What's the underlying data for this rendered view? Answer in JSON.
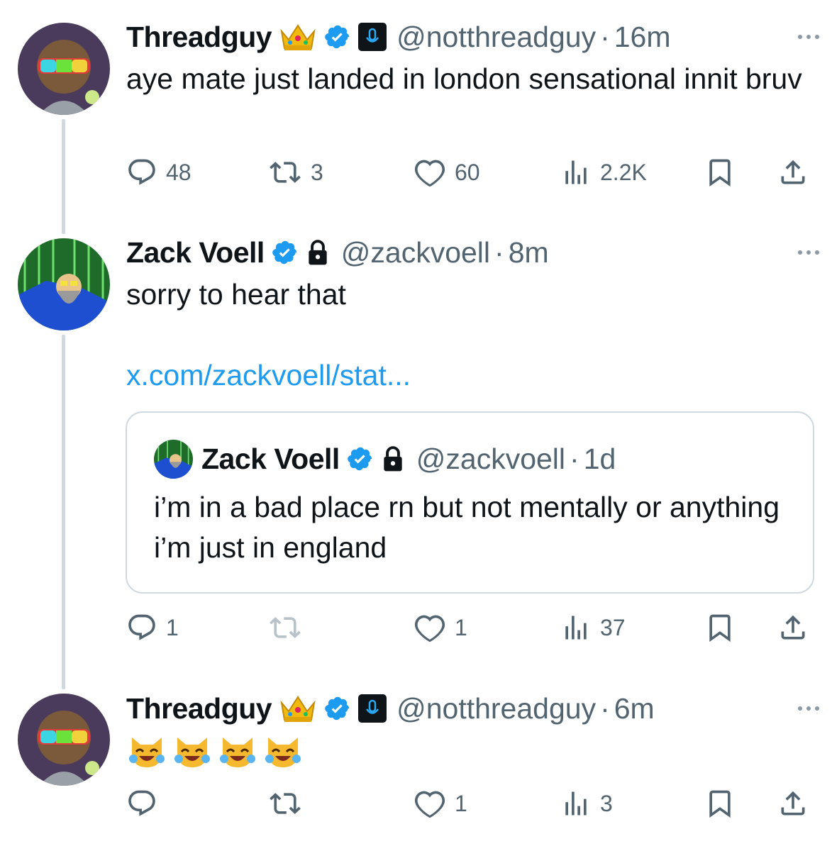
{
  "tweets": [
    {
      "display_name": "Threadguy",
      "handle": "@notthreadguy",
      "separator": "·",
      "time": "16m",
      "text": "aye mate just landed in london sensational innit bruv",
      "stats": {
        "replies": "48",
        "reposts": "3",
        "likes": "60",
        "views": "2.2K"
      }
    },
    {
      "display_name": "Zack Voell",
      "handle": "@zackvoell",
      "separator": "·",
      "time": "8m",
      "text": "sorry to hear that",
      "link": "x.com/zackvoell/stat...",
      "quote": {
        "display_name": "Zack Voell",
        "handle": "@zackvoell",
        "separator": "·",
        "time": "1d",
        "text": "i’m in a bad place rn but not mentally or anything i’m just in england"
      },
      "stats": {
        "replies": "1",
        "reposts": "",
        "likes": "1",
        "views": "37"
      }
    },
    {
      "display_name": "Threadguy",
      "handle": "@notthreadguy",
      "separator": "·",
      "time": "6m",
      "emojis": [
        "crying-laughing-cat",
        "crying-laughing-cat",
        "crying-laughing-cat",
        "crying-laughing-cat"
      ],
      "stats": {
        "replies": "",
        "reposts": "",
        "likes": "1",
        "views": "3"
      }
    }
  ],
  "icons": {
    "reply": "reply-icon",
    "repost": "repost-icon",
    "like": "like-icon",
    "views": "views-icon",
    "bookmark": "bookmark-icon",
    "share": "share-icon",
    "verified": "verified-badge-icon",
    "crown": "crown-icon",
    "mic": "microphone-badge-icon",
    "lock": "lock-icon",
    "more": "more-options-icon"
  },
  "colors": {
    "text": "#0f1419",
    "secondary": "#536471",
    "link": "#1d9bf0",
    "verified": "#1d9bf0",
    "thread_line": "#cfd9de"
  }
}
